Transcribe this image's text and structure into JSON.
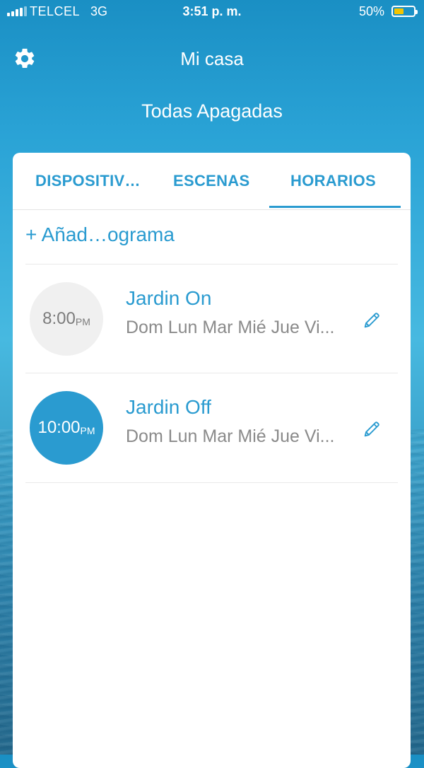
{
  "status_bar": {
    "carrier": "TELCEL",
    "network": "3G",
    "time": "3:51 p. m.",
    "battery_percent": "50%",
    "battery_level": 0.5
  },
  "header": {
    "settings_icon": "gear-icon",
    "title": "Mi casa",
    "subtitle": "Todas Apagadas"
  },
  "tabs": [
    {
      "label": "DISPOSITIV…",
      "active": false
    },
    {
      "label": "ESCENAS",
      "active": false
    },
    {
      "label": "HORARIOS",
      "active": true
    }
  ],
  "add_program": {
    "label": "+ Añad…ograma"
  },
  "schedules": [
    {
      "name": "Jardin On",
      "time": "8:00",
      "ampm": "PM",
      "days": "Dom Lun Mar Mié Jue Vi...",
      "enabled": false
    },
    {
      "name": "Jardin Off",
      "time": "10:00",
      "ampm": "PM",
      "days": "Dom Lun Mar Mié Jue Vi...",
      "enabled": true
    }
  ],
  "colors": {
    "accent": "#2a9bd0",
    "battery": "#f5c400",
    "inactive_circle": "#f0f0f0"
  }
}
